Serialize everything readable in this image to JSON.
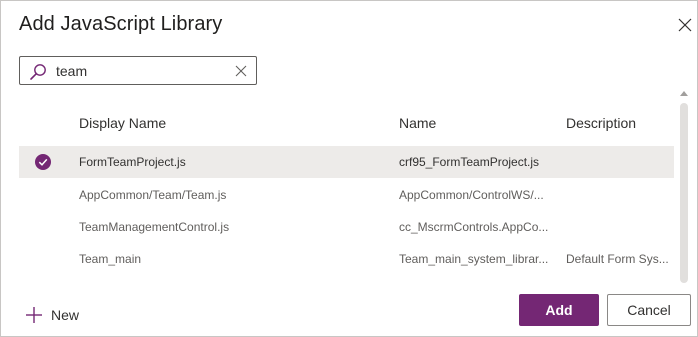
{
  "dialog": {
    "title": "Add JavaScript Library",
    "close_icon": "close-icon"
  },
  "search": {
    "value": "team",
    "placeholder": "Search",
    "icon": "search-icon",
    "clear_icon": "clear-icon"
  },
  "table": {
    "columns": [
      "Display Name",
      "Name",
      "Description"
    ],
    "rows": [
      {
        "display_name": "FormTeamProject.js",
        "name": "crf95_FormTeamProject.js",
        "description": "",
        "selected": true
      },
      {
        "display_name": "AppCommon/Team/Team.js",
        "name": "AppCommon/ControlWS/...",
        "description": "",
        "selected": false
      },
      {
        "display_name": "TeamManagementControl.js",
        "name": "cc_MscrmControls.AppCo...",
        "description": "",
        "selected": false
      },
      {
        "display_name": "Team_main",
        "name": "Team_main_system_librar...",
        "description": "Default Form Sys...",
        "selected": false
      }
    ]
  },
  "footer": {
    "new_label": "New",
    "add_label": "Add",
    "cancel_label": "Cancel"
  },
  "colors": {
    "accent": "#742774",
    "selected_row": "#edebe9"
  }
}
